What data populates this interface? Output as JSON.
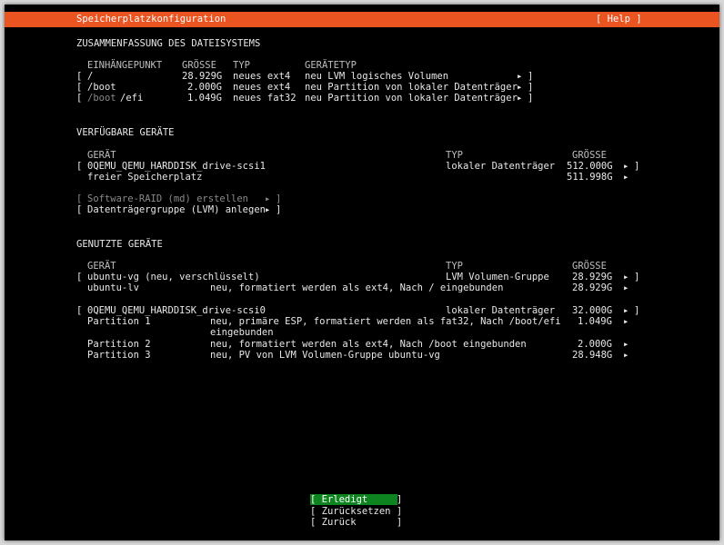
{
  "title": "Speicherplatzkonfiguration",
  "help_label": "[ Help ]",
  "fs_summary": {
    "heading": "ZUSAMMENFASSUNG DES DATEISYSTEMS",
    "columns": [
      "EINHÄNGEPUNKT",
      "GRÖSSE",
      "TYP",
      "GERÄTETYP"
    ],
    "rows": [
      {
        "mount_prefix": "/",
        "mount_suffix": "",
        "size": "28.929G",
        "type": "neues ext4",
        "devtype": "neu LVM logisches Volumen"
      },
      {
        "mount_prefix": "/boot",
        "mount_suffix": "",
        "size": "2.000G",
        "type": "neues ext4",
        "devtype": "neu Partition von lokaler Datenträger"
      },
      {
        "mount_prefix": "/boot",
        "mount_suffix": "/efi",
        "size": "1.049G",
        "type": "neues fat32",
        "devtype": "neu Partition von lokaler Datenträger"
      }
    ]
  },
  "available": {
    "heading": "VERFÜGBARE GERÄTE",
    "columns": [
      "GERÄT",
      "TYP",
      "GRÖSSE"
    ],
    "disk": {
      "name": "0QEMU_QEMU_HARDDISK_drive-scsi1",
      "type": "lokaler Datenträger",
      "size": "512.000G"
    },
    "free": {
      "label": "freier Speicherplatz",
      "size": "511.998G"
    },
    "actions": [
      "Software-RAID (md) erstellen",
      "Datenträgergruppe (LVM) anlegen"
    ]
  },
  "used": {
    "heading": "GENUTZTE GERÄTE",
    "columns": [
      "GERÄT",
      "TYP",
      "GRÖSSE"
    ],
    "vg": {
      "name": "ubuntu-vg (neu, verschlüsselt)",
      "type": "LVM Volumen-Gruppe",
      "size": "28.929G"
    },
    "lv": {
      "name": "ubuntu-lv",
      "desc": "neu, formatiert werden als ext4, Nach / eingebunden",
      "size": "28.929G"
    },
    "disk": {
      "name": "0QEMU_QEMU_HARDDISK_drive-scsi0",
      "type": "lokaler Datenträger",
      "size": "32.000G"
    },
    "partitions": [
      {
        "name": "Partition 1",
        "desc": "neu, primäre ESP, formatiert werden als fat32, Nach /boot/efi",
        "desc2": "eingebunden",
        "size": "1.049G"
      },
      {
        "name": "Partition 2",
        "desc": "neu, formatiert werden als ext4, Nach /boot eingebunden",
        "desc2": "",
        "size": "2.000G"
      },
      {
        "name": "Partition 3",
        "desc": "neu, PV von LVM Volumen-Gruppe ubuntu-vg",
        "desc2": "",
        "size": "28.948G"
      }
    ]
  },
  "buttons": {
    "done": "[ Erledigt     ]",
    "reset": "[ Zurücksetzen ]",
    "back": "[ Zurück       ]"
  },
  "glyphs": {
    "arrow": "▸",
    "open": "[",
    "close": "]"
  },
  "colors": {
    "title_bg": "#e95420",
    "focus_bg": "#0e8420"
  }
}
